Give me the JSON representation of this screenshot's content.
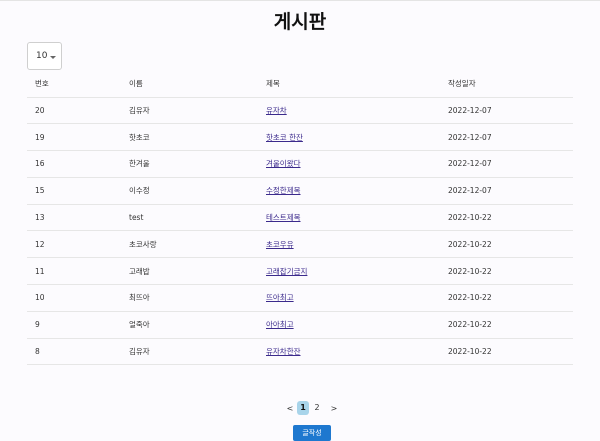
{
  "page": {
    "title": "게시판"
  },
  "page_size": {
    "selected": "10"
  },
  "table": {
    "headers": [
      "번호",
      "이름",
      "제목",
      "작성일자"
    ],
    "rows": [
      {
        "no": "20",
        "name": "김유자",
        "title": "유자차",
        "date": "2022-12-07"
      },
      {
        "no": "19",
        "name": "핫초코",
        "title": "핫초코 한잔",
        "date": "2022-12-07"
      },
      {
        "no": "16",
        "name": "한겨울",
        "title": "겨울이왔다",
        "date": "2022-12-07"
      },
      {
        "no": "15",
        "name": "이수정",
        "title": "수정한제목",
        "date": "2022-12-07"
      },
      {
        "no": "13",
        "name": "test",
        "title": "테스트제목",
        "date": "2022-10-22"
      },
      {
        "no": "12",
        "name": "초코사랑",
        "title": "초코우유",
        "date": "2022-10-22"
      },
      {
        "no": "11",
        "name": "고래밥",
        "title": "고래잡기금지",
        "date": "2022-10-22"
      },
      {
        "no": "10",
        "name": "최뜨아",
        "title": "뜨아최고",
        "date": "2022-10-22"
      },
      {
        "no": "9",
        "name": "얼죽아",
        "title": "아아최고",
        "date": "2022-10-22"
      },
      {
        "no": "8",
        "name": "김유자",
        "title": "유자차한잔",
        "date": "2022-10-22"
      }
    ]
  },
  "pagination": {
    "prev": "<",
    "pages": [
      "1",
      "2"
    ],
    "current": "1",
    "next": ">"
  },
  "actions": {
    "write_label": "글작성"
  },
  "colors": {
    "accent": "#1e78cf",
    "active_page": "#a8d4ea",
    "link": "#3b2a8c"
  }
}
